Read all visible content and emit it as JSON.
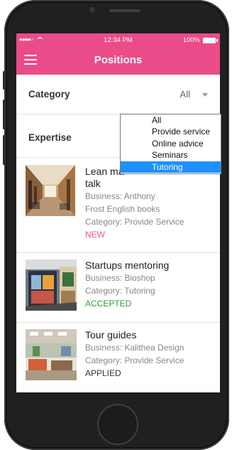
{
  "statusbar": {
    "signal": "●●●●○",
    "time": "12:34 PM",
    "battery": "100%"
  },
  "header": {
    "title": "Positions"
  },
  "filters": {
    "category": {
      "label": "Category",
      "value": "All"
    },
    "expertise": {
      "label": "Expertise"
    }
  },
  "dropdown": {
    "options": [
      "All",
      "Provide service",
      "Online advice",
      "Seminars",
      "Tutoring"
    ],
    "selected": "Tutoring"
  },
  "positions": [
    {
      "title_line1": "Lean ma",
      "title_line2": "talk",
      "business": "Business: Anthony",
      "business_line2": "Frost English books",
      "category": "Category: Provide Service",
      "status": "NEW",
      "status_color": "#e8508f"
    },
    {
      "title_line1": "Startups mentoring",
      "business": "Business: Bioshop",
      "category": "Category: Tutoring",
      "status": "ACCEPTED",
      "status_color": "#2e9a3a"
    },
    {
      "title_line1": "Tour guides",
      "business": "Business: Kalithea Design",
      "category": "Category: Provide Service",
      "status": "APPLIED",
      "status_color": "#333333"
    }
  ],
  "colors": {
    "brand": "#ea4c89",
    "dropdown_highlight": "#1e90ff"
  }
}
